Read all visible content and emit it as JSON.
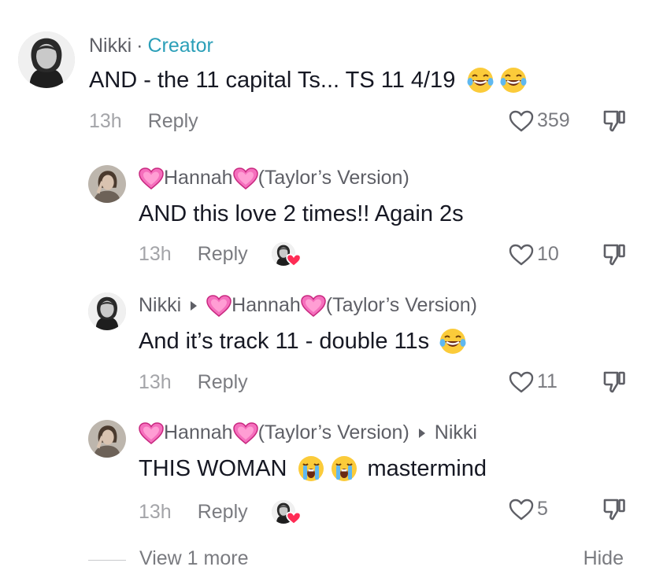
{
  "comments": [
    {
      "author": "Nikki",
      "separator": "·",
      "tag": "Creator",
      "text": "AND - the 11 capital Ts... TS 11 4/19",
      "emojis": [
        "laughing-tears-emoji",
        "laughing-tears-emoji"
      ],
      "time": "13h",
      "reply_label": "Reply",
      "likes": "359"
    },
    {
      "author_suffix": "Hannah",
      "author_version": "(Taylor’s Version)",
      "text": "AND this love 2 times!! Again 2s",
      "time": "13h",
      "reply_label": "Reply",
      "likes": "10"
    },
    {
      "author": "Nikki",
      "reply_to_name": "Hannah",
      "reply_to_version": "(Taylor’s Version)",
      "text": "And it’s track 11 - double 11s",
      "emojis": [
        "laughing-tears-emoji"
      ],
      "time": "13h",
      "reply_label": "Reply",
      "likes": "11"
    },
    {
      "author_suffix": "Hannah",
      "author_version": "(Taylor’s Version)",
      "reply_to": "Nikki",
      "text_before": "THIS WOMAN",
      "emojis": [
        "crying-emoji",
        "crying-emoji"
      ],
      "text_after": "mastermind",
      "time": "13h",
      "reply_label": "Reply",
      "likes": "5"
    }
  ],
  "footer": {
    "view_more_label": "View 1 more",
    "hide_label": "Hide"
  },
  "colors": {
    "creator_accent": "#2b9fb8",
    "text_primary": "#161823",
    "text_secondary": "#5e5f66",
    "heart_emoji": "#f04fa0"
  }
}
